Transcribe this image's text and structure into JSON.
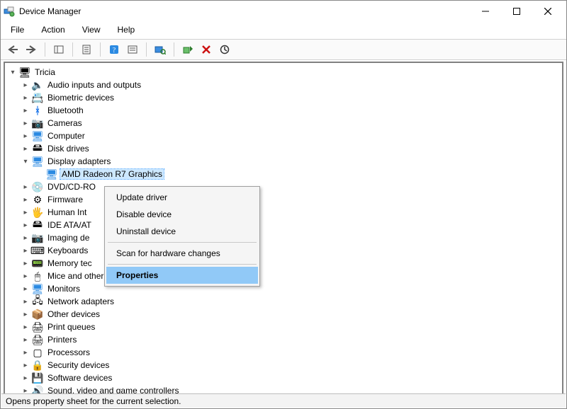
{
  "window": {
    "title": "Device Manager"
  },
  "menus": {
    "file": "File",
    "action": "Action",
    "view": "View",
    "help": "Help"
  },
  "tree": {
    "root": "Tricia",
    "items": [
      {
        "label": "Audio inputs and outputs",
        "icon": "🔈",
        "expanded": false
      },
      {
        "label": "Biometric devices",
        "icon": "📇",
        "expanded": false
      },
      {
        "label": "Bluetooth",
        "icon": "ᚼ",
        "expanded": false
      },
      {
        "label": "Cameras",
        "icon": "📷",
        "expanded": false
      },
      {
        "label": "Computer",
        "icon": "🖥",
        "expanded": false
      },
      {
        "label": "Disk drives",
        "icon": "🖴",
        "expanded": false
      },
      {
        "label": "Display adapters",
        "icon": "🖥",
        "expanded": true,
        "children": [
          {
            "label": "AMD Radeon R7 Graphics",
            "icon": "🖥",
            "selected": true
          }
        ]
      },
      {
        "label": "DVD/CD-RO",
        "icon": "💿",
        "expanded": false
      },
      {
        "label": "Firmware",
        "icon": "⚙",
        "expanded": false
      },
      {
        "label": "Human Int",
        "icon": "🖐",
        "expanded": false
      },
      {
        "label": "IDE ATA/AT",
        "icon": "🖴",
        "expanded": false
      },
      {
        "label": "Imaging de",
        "icon": "📷",
        "expanded": false
      },
      {
        "label": "Keyboards",
        "icon": "⌨",
        "expanded": false
      },
      {
        "label": "Memory tec",
        "icon": "📟",
        "expanded": false
      },
      {
        "label": "Mice and other pointing devices",
        "icon": "🖱",
        "expanded": false
      },
      {
        "label": "Monitors",
        "icon": "🖥",
        "expanded": false
      },
      {
        "label": "Network adapters",
        "icon": "🖧",
        "expanded": false
      },
      {
        "label": "Other devices",
        "icon": "📦",
        "expanded": false
      },
      {
        "label": "Print queues",
        "icon": "🖨",
        "expanded": false
      },
      {
        "label": "Printers",
        "icon": "🖨",
        "expanded": false
      },
      {
        "label": "Processors",
        "icon": "▢",
        "expanded": false
      },
      {
        "label": "Security devices",
        "icon": "🔒",
        "expanded": false
      },
      {
        "label": "Software devices",
        "icon": "💾",
        "expanded": false
      },
      {
        "label": "Sound, video and game controllers",
        "icon": "🔊",
        "expanded": false
      }
    ]
  },
  "context_menu": {
    "update": "Update driver",
    "disable": "Disable device",
    "uninstall": "Uninstall device",
    "scan": "Scan for hardware changes",
    "properties": "Properties"
  },
  "statusbar": {
    "text": "Opens property sheet for the current selection."
  }
}
